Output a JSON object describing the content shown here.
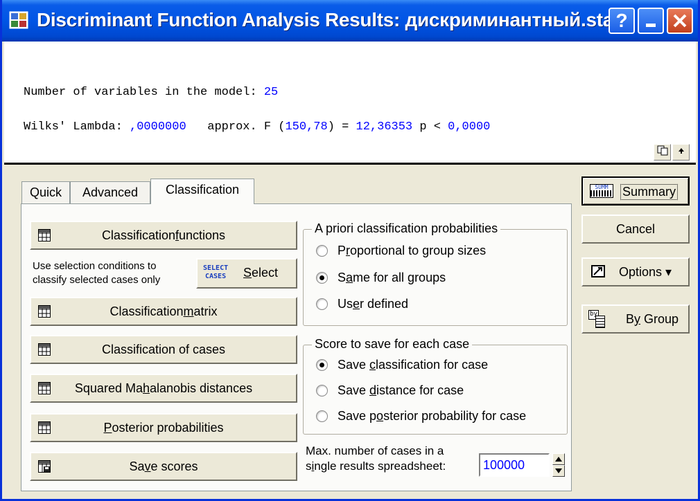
{
  "window": {
    "title": "Discriminant Function Analysis Results: дискриминантный.sta",
    "help_label": "?"
  },
  "results": {
    "line1_label": "Number of variables in the model: ",
    "line1_value": "25",
    "line2_label": "Wilks' Lambda: ",
    "line2_lambda": ",0000000",
    "line2_mid": "   approx. F (",
    "line2_df": "150,78",
    "line2_eq": ") = ",
    "line2_f": "12,36353",
    "line2_p": " p < ",
    "line2_pval": "0,0000",
    "colors": {
      "value": "#0000ff",
      "text": "#000000"
    }
  },
  "tabs": [
    {
      "label": "Quick"
    },
    {
      "label": "Advanced"
    },
    {
      "label": "Classification"
    }
  ],
  "buttons": {
    "classification_functions": {
      "pre": "Classification ",
      "u": "f",
      "post": "unctions"
    },
    "selection_text": {
      "line1": "Use selection conditions to",
      "line2": "classify selected cases only"
    },
    "select_icon": {
      "line1": "SELECT",
      "line2": "CASES"
    },
    "select": {
      "pre": "",
      "u": "S",
      "post": "elect"
    },
    "classification_matrix": {
      "pre": "Classification ",
      "u": "m",
      "post": "atrix"
    },
    "classification_of_cases": {
      "pre": "Classification of cases",
      "u": "",
      "post": ""
    },
    "squared_mahalanobis": {
      "pre": "Squared Ma",
      "u": "h",
      "post": "alanobis distances"
    },
    "posterior_probabilities": {
      "pre": "",
      "u": "P",
      "post": "osterior probabilities"
    },
    "save_scores": {
      "pre": "Sa",
      "u": "v",
      "post": "e scores"
    }
  },
  "apriori": {
    "title": "A priori classification probabilities",
    "options": [
      {
        "pre": "P",
        "u": "r",
        "post": "oportional to group sizes",
        "selected": false
      },
      {
        "pre": "S",
        "u": "a",
        "post": "me for all groups",
        "selected": true
      },
      {
        "pre": "Us",
        "u": "e",
        "post": "r defined",
        "selected": false
      }
    ]
  },
  "score": {
    "title": "Score to save for each case",
    "options": [
      {
        "pre": "Save ",
        "u": "c",
        "post": "lassification for case",
        "selected": true
      },
      {
        "pre": "Save ",
        "u": "d",
        "post": "istance for case",
        "selected": false
      },
      {
        "pre": "Save p",
        "u": "o",
        "post": "sterior probability for case",
        "selected": false
      }
    ]
  },
  "max_cases": {
    "line1": "Max. number of cases in a",
    "line2_pre": "s",
    "line2_u": "i",
    "line2_post": "ngle results spreadsheet:",
    "value": "100000"
  },
  "side": {
    "summary_icon": "SUMM",
    "summary": "Summary",
    "cancel": "Cancel",
    "options": "Options ▾",
    "by_group_icon": "by",
    "by_group": {
      "pre": "B",
      "u": "y",
      "post": " Group"
    }
  }
}
